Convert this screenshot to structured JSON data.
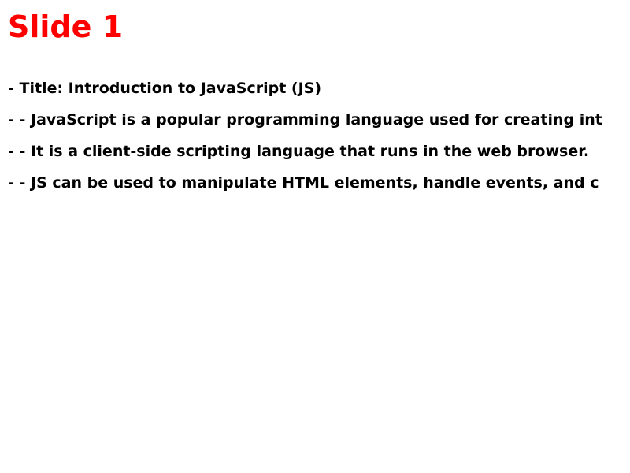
{
  "slide": {
    "title": "Slide 1",
    "title_color": "#ff0000",
    "text_color": "#000000",
    "background": "#ffffff",
    "bullets": [
      "- Title: Introduction to JavaScript (JS)",
      "- - JavaScript is a popular programming language used for creating int",
      "- - It is a client-side scripting language that runs in the web browser.",
      "- - JS can be used to manipulate HTML elements, handle events, and c"
    ]
  }
}
